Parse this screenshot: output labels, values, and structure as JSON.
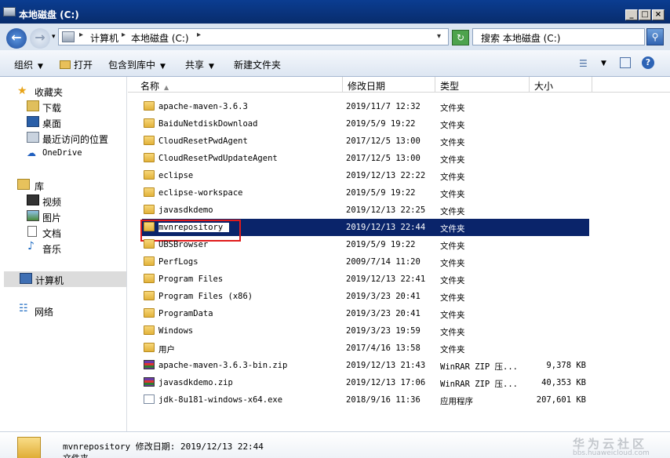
{
  "window": {
    "title": "本地磁盘 (C:)",
    "buttons": {
      "minimize": "_",
      "maximize": "□",
      "close": "×"
    }
  },
  "address": {
    "crumbs": [
      "计算机",
      "本地磁盘 (C:)"
    ],
    "search_placeholder": "搜索 本地磁盘 (C:)"
  },
  "toolbar": {
    "organize": "组织",
    "open": "打开",
    "include_in_library": "包含到库中",
    "share": "共享",
    "new_folder": "新建文件夹"
  },
  "nav": {
    "favorites": "收藏夹",
    "downloads": "下载",
    "desktop": "桌面",
    "recent": "最近访问的位置",
    "onedrive": "OneDrive",
    "libraries": "库",
    "videos": "视频",
    "pictures": "图片",
    "documents": "文档",
    "music": "音乐",
    "computer": "计算机",
    "network": "网络"
  },
  "columns": {
    "name": "名称",
    "date": "修改日期",
    "type": "类型",
    "size": "大小"
  },
  "files": [
    {
      "name": "apache-maven-3.6.3",
      "date": "2019/11/7 12:32",
      "type": "文件夹",
      "size": "",
      "icon": "folder-icon"
    },
    {
      "name": "BaiduNetdiskDownload",
      "date": "2019/5/9 19:22",
      "type": "文件夹",
      "size": "",
      "icon": "folder-icon"
    },
    {
      "name": "CloudResetPwdAgent",
      "date": "2017/12/5 13:00",
      "type": "文件夹",
      "size": "",
      "icon": "folder-icon"
    },
    {
      "name": "CloudResetPwdUpdateAgent",
      "date": "2017/12/5 13:00",
      "type": "文件夹",
      "size": "",
      "icon": "folder-icon"
    },
    {
      "name": "eclipse",
      "date": "2019/12/13 22:22",
      "type": "文件夹",
      "size": "",
      "icon": "folder-icon"
    },
    {
      "name": "eclipse-workspace",
      "date": "2019/5/9 19:22",
      "type": "文件夹",
      "size": "",
      "icon": "folder-icon"
    },
    {
      "name": "javasdkdemo",
      "date": "2019/12/13 22:25",
      "type": "文件夹",
      "size": "",
      "icon": "folder-icon"
    },
    {
      "name": "mvnrepository",
      "date": "2019/12/13 22:44",
      "type": "文件夹",
      "size": "",
      "icon": "folder-icon"
    },
    {
      "name": "UBSBrowser",
      "date": "2019/5/9 19:22",
      "type": "文件夹",
      "size": "",
      "icon": "folder-icon"
    },
    {
      "name": "PerfLogs",
      "date": "2009/7/14 11:20",
      "type": "文件夹",
      "size": "",
      "icon": "folder-icon"
    },
    {
      "name": "Program Files",
      "date": "2019/12/13 22:41",
      "type": "文件夹",
      "size": "",
      "icon": "folder-icon"
    },
    {
      "name": "Program Files (x86)",
      "date": "2019/3/23 20:41",
      "type": "文件夹",
      "size": "",
      "icon": "folder-icon"
    },
    {
      "name": "ProgramData",
      "date": "2019/3/23 20:41",
      "type": "文件夹",
      "size": "",
      "icon": "folder-icon"
    },
    {
      "name": "Windows",
      "date": "2019/3/23 19:59",
      "type": "文件夹",
      "size": "",
      "icon": "folder-icon"
    },
    {
      "name": "用户",
      "date": "2017/4/16 13:58",
      "type": "文件夹",
      "size": "",
      "icon": "folder-icon"
    },
    {
      "name": "apache-maven-3.6.3-bin.zip",
      "date": "2019/12/13 21:43",
      "type": "WinRAR ZIP 压...",
      "size": "9,378 KB",
      "icon": "winrar-zip-icon"
    },
    {
      "name": "javasdkdemo.zip",
      "date": "2019/12/13 17:06",
      "type": "WinRAR ZIP 压...",
      "size": "40,353 KB",
      "icon": "winrar-zip-icon"
    },
    {
      "name": "jdk-8u181-windows-x64.exe",
      "date": "2018/9/16 11:36",
      "type": "应用程序",
      "size": "207,601 KB",
      "icon": "installer-icon"
    }
  ],
  "selected_index": 7,
  "details": {
    "name": "mvnrepository",
    "modified_label": "修改日期:",
    "modified_value": "2019/12/13 22:44",
    "type": "文件夹"
  },
  "watermark": {
    "brand": "华为云社区",
    "url": "bbs.huaweicloud.com"
  }
}
